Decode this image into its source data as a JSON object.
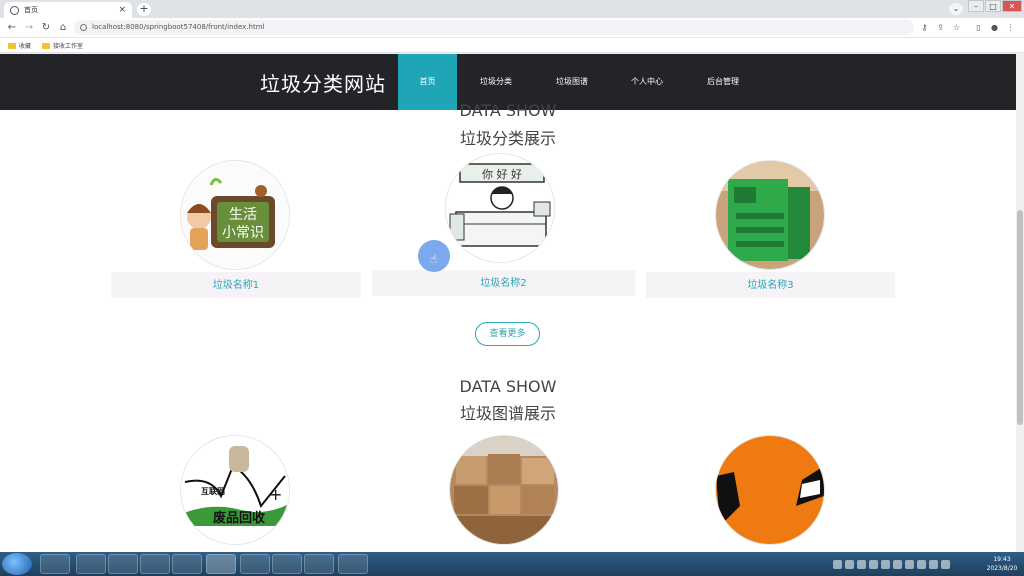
{
  "browser": {
    "tab_title": "首页",
    "tab_close": "×",
    "new_tab": "+",
    "tab_menu": "⌄",
    "url": "localhost:8080/springboot57408/front/index.html",
    "bookmarks": [
      "收藏",
      "接收工作室"
    ],
    "window_controls": [
      "–",
      "□",
      "✕"
    ]
  },
  "site": {
    "title": "垃圾分类网站",
    "nav": [
      {
        "label": "首页",
        "active": true
      },
      {
        "label": "垃圾分类",
        "active": false
      },
      {
        "label": "垃圾图谱",
        "active": false
      },
      {
        "label": "个人中心",
        "active": false
      },
      {
        "label": "后台管理",
        "active": false
      }
    ],
    "section1": {
      "en": "DATA SHOW",
      "cn": "垃圾分类展示",
      "cards": [
        {
          "name": "垃圾名称1",
          "image": "life-tips-illustration",
          "image_text": "生活\n小常识"
        },
        {
          "name": "垃圾名称2",
          "image": "cartoon-stall-illustration",
          "image_text": "你 好 好"
        },
        {
          "name": "垃圾名称3",
          "image": "green-recycling-bin-photo"
        }
      ],
      "more_label": "查看更多"
    },
    "section2": {
      "en": "DATA SHOW",
      "cn": "垃圾图谱展示",
      "cards": [
        {
          "image": "waste-recycling-handshake",
          "image_text_top": "互联网",
          "image_text_plus": "+",
          "image_text": "废品回收"
        },
        {
          "image": "paper-bales-photo"
        },
        {
          "image": "orange-abstract-illustration"
        }
      ]
    }
  },
  "taskbar": {
    "time": "19:43",
    "date": "2023/8/20"
  },
  "colors": {
    "nav_bg": "#222428",
    "accent": "#1ea5b6",
    "card_bar": "#f6f3f7"
  }
}
